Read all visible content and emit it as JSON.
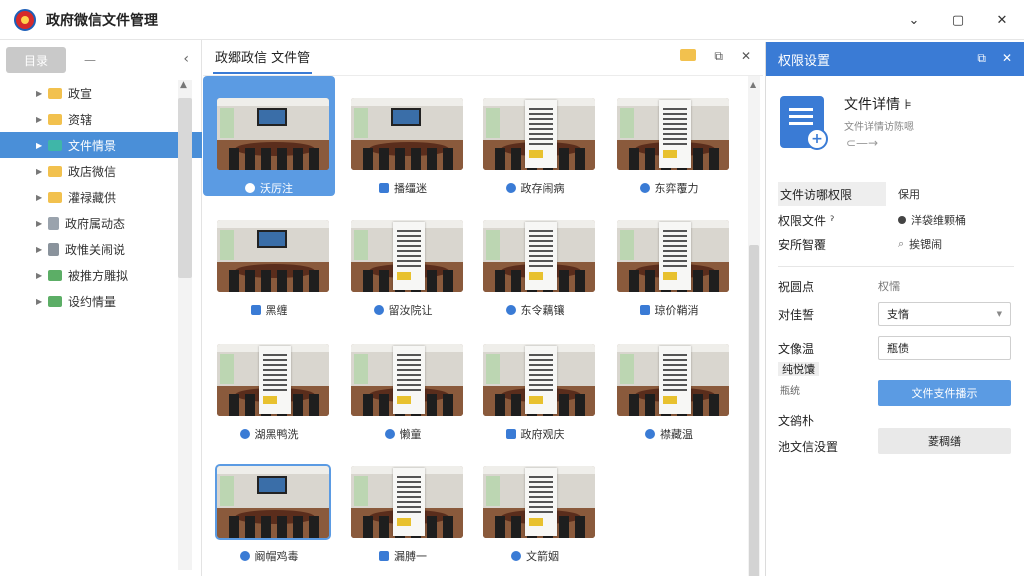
{
  "window": {
    "title": "政府微信文件管理",
    "controls": {
      "min": "⌄",
      "max": "▢",
      "close": "✕"
    }
  },
  "sidebar": {
    "tab_label": "目录",
    "dash": "—",
    "collapse": "‹",
    "scroll_up": "▲",
    "scroll_down": "▼",
    "items": [
      {
        "label": "政宣",
        "icon": "folder"
      },
      {
        "label": "资辖",
        "icon": "folder"
      },
      {
        "label": "文件情景",
        "icon": "folder-open",
        "active": true
      },
      {
        "label": "政店微信",
        "icon": "folder"
      },
      {
        "label": "灌禄藏供",
        "icon": "folder"
      },
      {
        "label": "政府属动态",
        "icon": "doc"
      },
      {
        "label": "政惟关闹说",
        "icon": "doc-alt"
      },
      {
        "label": "被推方雕拟",
        "icon": "folder-green"
      },
      {
        "label": "设约情量",
        "icon": "folder-green"
      }
    ]
  },
  "center": {
    "tab_label": "政郷政信  文件管",
    "icons": {
      "folder": "folder-icon",
      "export": "⧉",
      "close": "✕"
    },
    "scroll_up": "▲",
    "files": [
      {
        "caption": "沃厉注",
        "type": "room",
        "selected": true
      },
      {
        "caption": "播缰迷",
        "type": "room"
      },
      {
        "caption": "政存闹病",
        "type": "paper"
      },
      {
        "caption": "东弈覆力",
        "type": "paper"
      },
      {
        "caption": "黑缠",
        "type": "room"
      },
      {
        "caption": "留汝院让",
        "type": "paper"
      },
      {
        "caption": "东令藕镶",
        "type": "paper"
      },
      {
        "caption": "琼价鞘消",
        "type": "paper"
      },
      {
        "caption": "湖黑鸭洗",
        "type": "paper"
      },
      {
        "caption": "懒童",
        "type": "paper"
      },
      {
        "caption": "政府观庆",
        "type": "paper"
      },
      {
        "caption": "襟藏温",
        "type": "paper"
      },
      {
        "caption": "阚帽鸡毒",
        "type": "room",
        "selected_outline": true
      },
      {
        "caption": "漏膊一",
        "type": "paper"
      },
      {
        "caption": "文箭姻",
        "type": "paper"
      }
    ]
  },
  "panel": {
    "title": "权限设置",
    "icons": {
      "popout": "⧉",
      "close": "✕"
    },
    "doc_title": "文件详情  ⊧",
    "doc_subtitle": "文件详情访陈嗯",
    "doc_arrow": "⊂—→",
    "doc_plus": "+",
    "rows": [
      {
        "label": "文件访哪权限",
        "value": "保用",
        "highlight": true
      },
      {
        "label": "权限文件 ˀ",
        "value": "洋袋维颗桶",
        "value_icon": "bullet"
      },
      {
        "label": "安所智覆",
        "value": "挨锶闹",
        "value_icon": "search"
      }
    ],
    "section2_label": "祝圆点",
    "section2_value": "权懦",
    "field1_label": "对佳誓",
    "field1_value": "支惰",
    "field2_label": "文像温",
    "field2_value": "瓶债",
    "pill_label": "纯悦馕",
    "note": "瓶统",
    "primary_button": "文件支件播示",
    "field3_label": "文鹆朴",
    "field4_label": "池文信没置",
    "secondary_button": "菱稠缮"
  }
}
